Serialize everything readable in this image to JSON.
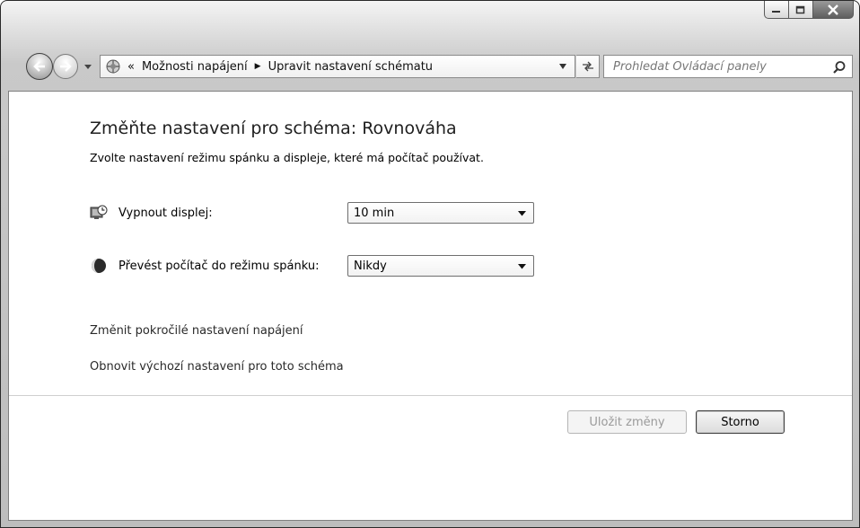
{
  "window": {
    "caption_buttons": [
      "minimize",
      "maximize",
      "close"
    ]
  },
  "addressbar": {
    "overflow": "«",
    "crumbs": [
      "Možnosti napájení",
      "Upravit nastavení schématu"
    ]
  },
  "search": {
    "placeholder": "Prohledat Ovládací panely"
  },
  "main": {
    "title": "Změňte nastavení pro schéma: Rovnováha",
    "subtitle": "Zvolte nastavení režimu spánku a displeje, které má počítač používat.",
    "settings": [
      {
        "label": "Vypnout displej:",
        "value": "10 min",
        "icon": "display-clock-icon"
      },
      {
        "label": "Převést počítač do režimu spánku:",
        "value": "Nikdy",
        "icon": "moon-icon"
      }
    ],
    "links": {
      "advanced": "Změnit pokročilé nastavení napájení",
      "restore": "Obnovit výchozí nastavení pro toto schéma"
    },
    "buttons": {
      "save": "Uložit změny",
      "cancel": "Storno"
    }
  }
}
